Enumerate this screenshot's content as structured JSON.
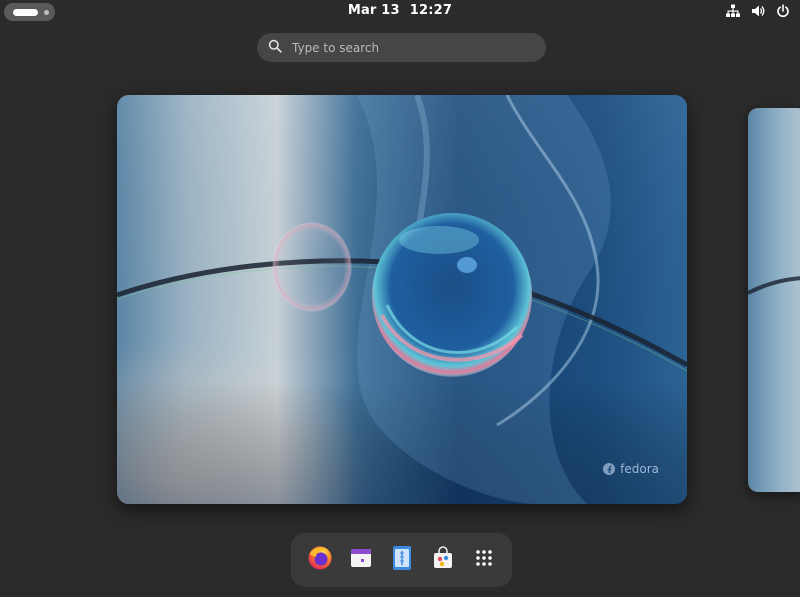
{
  "topbar": {
    "clock_date": "Mar 13",
    "clock_time": "12:27",
    "status_icons": [
      "network-wired-icon",
      "volume-icon",
      "power-icon"
    ]
  },
  "search": {
    "placeholder": "Type to search"
  },
  "wallpaper": {
    "brand_text": "fedora"
  },
  "dash": {
    "apps": [
      {
        "name": "Firefox",
        "icon": "firefox-icon"
      },
      {
        "name": "Calendar",
        "icon": "calendar-icon"
      },
      {
        "name": "Text Editor",
        "icon": "text-editor-icon"
      },
      {
        "name": "Software",
        "icon": "software-icon"
      },
      {
        "name": "Show Apps",
        "icon": "app-grid-icon"
      }
    ]
  },
  "colors": {
    "background": "#2b2b2b",
    "search_bg": "#464646",
    "dash_bg": "#3a3a3a",
    "activities_bg": "#5a5a5a"
  }
}
